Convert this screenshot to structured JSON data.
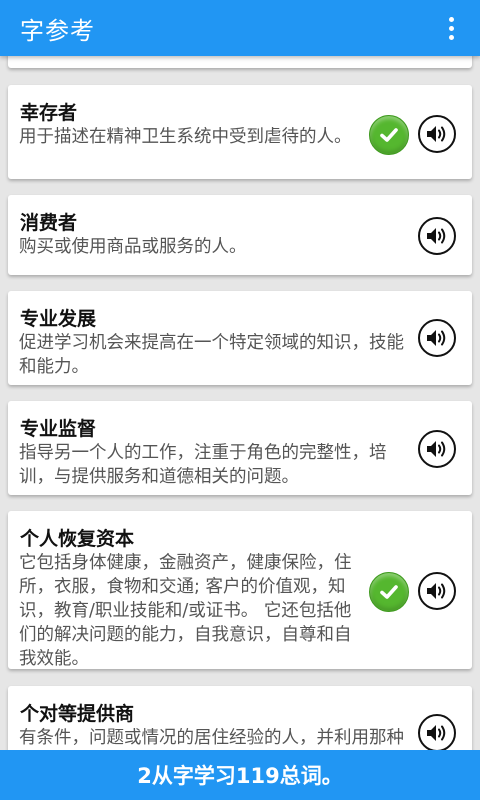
{
  "app": {
    "title": "字参考",
    "menu_icon": "more-vert-icon"
  },
  "terms": [
    {
      "term": "幸存者",
      "definition": "用于描述在精神卫生系统中受到虐待的人。",
      "learned": true
    },
    {
      "term": "消费者",
      "definition": "购买或使用商品或服务的人。",
      "learned": false
    },
    {
      "term": "专业发展",
      "definition": "促进学习机会来提高在一个特定领域的知识，技能和能力。",
      "learned": false
    },
    {
      "term": "专业监督",
      "definition": "指导另一个人的工作，注重于角色的完整性，培训，与提供服务和道德相关的问题。",
      "learned": false
    },
    {
      "term": "个人恢复资本",
      "definition": "它包括身体健康，金融资产，健康保险，住所，衣服，食物和交通; 客户的价值观，知识，教育/职业技能和/或证书。 它还包括他们的解决问题的能力，自我意识，自尊和自我效能。",
      "learned": true
    },
    {
      "term": "个对等提供商",
      "definition": "有条件，问题或情况的居住经验的人，并利用那种经验来帮助他人",
      "learned": false
    }
  ],
  "footer": {
    "text": "2从字学习119总词。"
  },
  "colors": {
    "primary": "#2196f3",
    "check": "#55b72f",
    "background": "#e6e6e6"
  }
}
